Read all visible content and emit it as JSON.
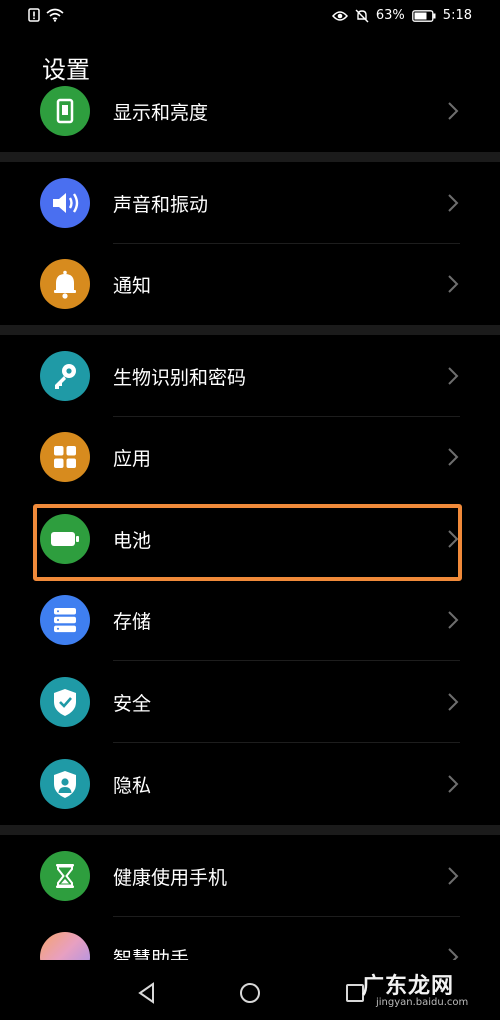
{
  "status_bar": {
    "battery_percent": "63%",
    "time": "5:18",
    "icons_left": [
      "alert-icon",
      "wifi-icon"
    ],
    "icons_right": [
      "eye-icon",
      "mute-icon",
      "battery-icon"
    ]
  },
  "header": {
    "title": "设置"
  },
  "settings": {
    "items": [
      {
        "label": "显示和亮度",
        "icon": "display-icon",
        "color": "#2e9e3e"
      },
      {
        "label": "声音和振动",
        "icon": "speaker-icon",
        "color": "#4a6ff0"
      },
      {
        "label": "通知",
        "icon": "bell-icon",
        "color": "#d78b1e"
      },
      {
        "label": "生物识别和密码",
        "icon": "key-icon",
        "color": "#1f9aa6"
      },
      {
        "label": "应用",
        "icon": "apps-icon",
        "color": "#d78b1e"
      },
      {
        "label": "电池",
        "icon": "battery-icon",
        "color": "#2e9e3e"
      },
      {
        "label": "存储",
        "icon": "storage-icon",
        "color": "#3f7ff0"
      },
      {
        "label": "安全",
        "icon": "shield-icon",
        "color": "#1f9aa6"
      },
      {
        "label": "隐私",
        "icon": "privacy-icon",
        "color": "#1f9aa6"
      },
      {
        "label": "健康使用手机",
        "icon": "hourglass-icon",
        "color": "#2e9e3e"
      },
      {
        "label": "智慧助手",
        "icon": "assistant-icon",
        "color": "#e8a0c0"
      }
    ]
  },
  "highlight": {
    "color": "#f08a3a",
    "target": "电池"
  },
  "nav_bar": {
    "icons": [
      "back-icon",
      "home-icon",
      "recents-icon"
    ]
  },
  "watermark": {
    "text": "广东龙网",
    "sub": "jingyan.baidu.com"
  }
}
